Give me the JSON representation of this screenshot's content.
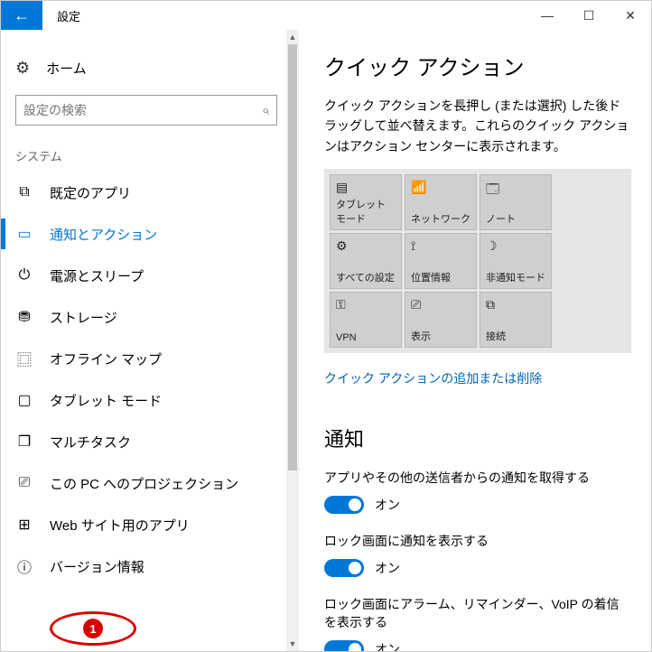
{
  "window": {
    "title": "設定"
  },
  "sidebar": {
    "home": "ホーム",
    "search_placeholder": "設定の検索",
    "category": "システム",
    "items": [
      {
        "icon": "app-default",
        "label": "既定のアプリ"
      },
      {
        "icon": "notification",
        "label": "通知とアクション",
        "selected": true
      },
      {
        "icon": "power",
        "label": "電源とスリープ"
      },
      {
        "icon": "storage",
        "label": "ストレージ"
      },
      {
        "icon": "map",
        "label": "オフライン マップ"
      },
      {
        "icon": "tablet",
        "label": "タブレット モード"
      },
      {
        "icon": "multitask",
        "label": "マルチタスク"
      },
      {
        "icon": "project",
        "label": "この PC へのプロジェクション"
      },
      {
        "icon": "webapps",
        "label": "Web サイト用のアプリ"
      },
      {
        "icon": "info",
        "label": "バージョン情報"
      }
    ]
  },
  "main": {
    "heading1": "クイック アクション",
    "desc": "クイック アクションを長押し (または選択) した後ドラッグして並べ替えます。これらのクイック アクションはアクション センターに表示されます。",
    "tiles": [
      {
        "label": "タブレット モード"
      },
      {
        "label": "ネットワーク"
      },
      {
        "label": "ノート"
      },
      {
        "label": "すべての設定"
      },
      {
        "label": "位置情報"
      },
      {
        "label": "非通知モード"
      },
      {
        "label": "VPN"
      },
      {
        "label": "表示"
      },
      {
        "label": "接続"
      }
    ],
    "qa_link": "クイック アクションの追加または削除",
    "heading2": "通知",
    "toggles": [
      {
        "label": "アプリやその他の送信者からの通知を取得する",
        "state": "オン"
      },
      {
        "label": "ロック画面に通知を表示する",
        "state": "オン"
      },
      {
        "label": "ロック画面にアラーム、リマインダー、VoIP の着信を表示する",
        "state": "オン"
      }
    ]
  },
  "annotation": {
    "number": "1"
  },
  "icons": {
    "app-default": "⧉",
    "notification": "▭",
    "power": "⏻",
    "storage": "⛃",
    "map": "⿴",
    "tablet": "▢",
    "multitask": "❐",
    "project": "⎚",
    "webapps": "⊞",
    "info": "ⓘ",
    "tile0": "▤",
    "tile1": "📶",
    "tile2": "🗔",
    "tile3": "⚙",
    "tile4": "⟟",
    "tile5": "☽",
    "tile6": "⚿",
    "tile7": "⎚",
    "tile8": "⧉"
  }
}
